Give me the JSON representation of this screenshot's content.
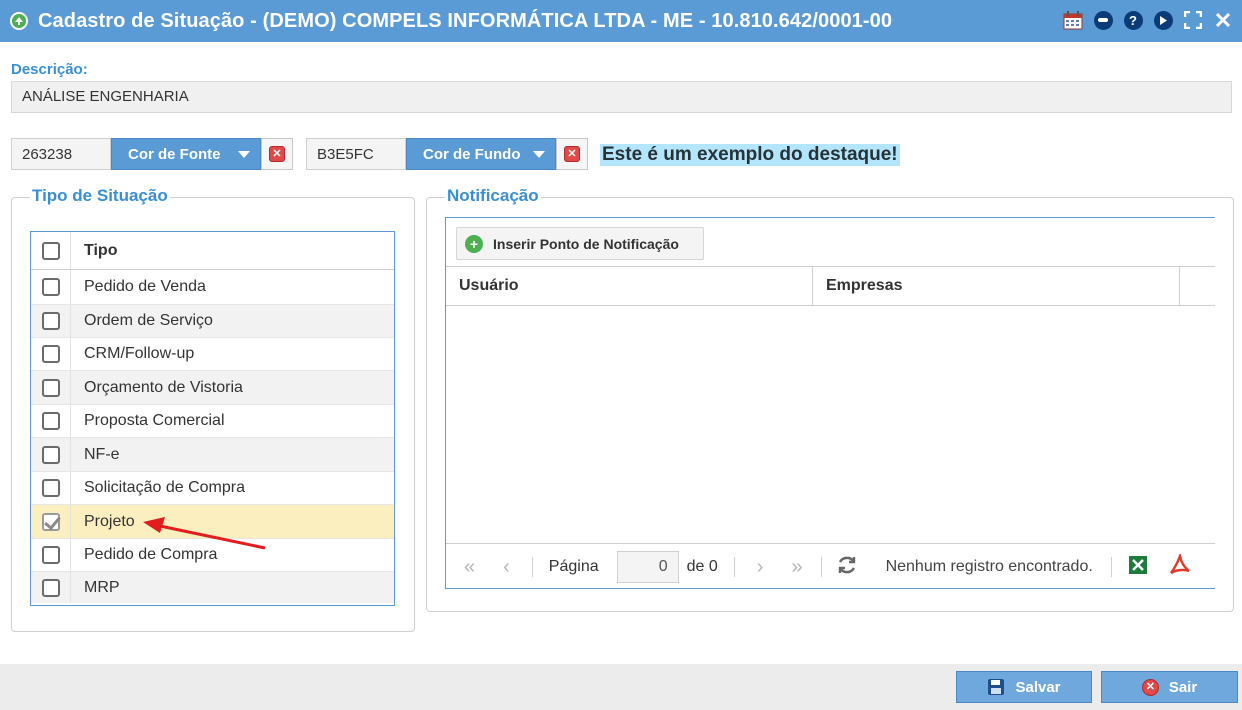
{
  "window": {
    "title": "Cadastro de Situação - (DEMO) COMPELS INFORMÁTICA LTDA - ME - 10.810.642/0001-00",
    "help_label": "?"
  },
  "form": {
    "descricao_label": "Descrição:",
    "descricao_value": "ANÁLISE ENGENHARIA",
    "font_color_value": "263238",
    "font_color_button": "Cor de Fonte",
    "bg_color_value": "B3E5FC",
    "bg_color_button": "Cor de Fundo",
    "sample_text": "Este é um exemplo do destaque!",
    "colors": {
      "font": "#263238",
      "background": "#B3E5FC"
    }
  },
  "tipo_situacao": {
    "legend": "Tipo de Situação",
    "header": "Tipo",
    "items": [
      {
        "label": "Pedido de Venda",
        "checked": false
      },
      {
        "label": "Ordem de Serviço",
        "checked": false
      },
      {
        "label": "CRM/Follow-up",
        "checked": false
      },
      {
        "label": "Orçamento de Vistoria",
        "checked": false
      },
      {
        "label": "Proposta Comercial",
        "checked": false
      },
      {
        "label": "NF-e",
        "checked": false
      },
      {
        "label": "Solicitação de Compra",
        "checked": false
      },
      {
        "label": "Projeto",
        "checked": true
      },
      {
        "label": "Pedido de Compra",
        "checked": false
      },
      {
        "label": "MRP",
        "checked": false
      }
    ]
  },
  "notificacao": {
    "legend": "Notificação",
    "add_button": "Inserir Ponto de Notificação",
    "columns": [
      "Usuário",
      "Empresas"
    ],
    "pager": {
      "page_label": "Página",
      "page_value": "0",
      "of_label": "de 0",
      "status": "Nenhum registro encontrado."
    }
  },
  "footer": {
    "save_label": "Salvar",
    "exit_label": "Sair"
  }
}
